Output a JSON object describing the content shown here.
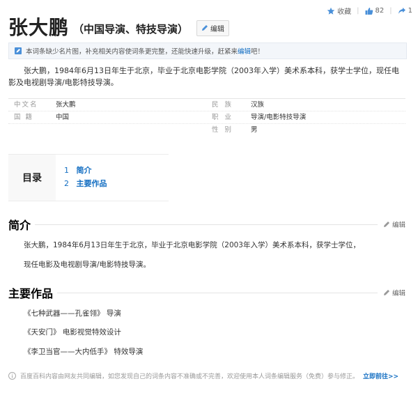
{
  "top": {
    "collect_label": "收藏",
    "like_count": "82",
    "share_count": "1"
  },
  "title": {
    "main": "张大鹏",
    "sub": "（中国导演、特技导演）",
    "edit_label": "编辑"
  },
  "notice": {
    "text": "本词条缺少名片图，补充相关内容使词条更完整，还能快速升级，赶紧来",
    "link": "编辑",
    "tail": "吧！"
  },
  "summary": "张大鹏，1984年6月13日年生于北京，毕业于北京电影学院（2003年入学）美术系本科，获学士学位，现任电影及电视剧导演/电影特技导演。",
  "basic_info": {
    "rows": [
      {
        "n1": "中文名",
        "v1": "张大鹏",
        "n2": "民 族",
        "v2": "汉族"
      },
      {
        "n1": "国 籍",
        "v1": "中国",
        "n2": "职 业",
        "v2": "导演/电影特技导演"
      },
      {
        "n1": "",
        "v1": "",
        "n2": "性 别",
        "v2": "男"
      }
    ]
  },
  "toc": {
    "label": "目录",
    "items": [
      {
        "num": "1",
        "text": "简介"
      },
      {
        "num": "2",
        "text": "主要作品"
      }
    ]
  },
  "section_intro": {
    "title": "简介",
    "edit_label": "编辑",
    "lines": [
      "张大鹏，1984年6月13日年生于北京，毕业于北京电影学院（2003年入学）美术系本科，获学士学位，",
      "现任电影及电视剧导演/电影特技导演。"
    ]
  },
  "section_works": {
    "title": "主要作品",
    "edit_label": "编辑",
    "items": [
      "《七种武器——孔雀翎》 导演",
      "《天安门》 电影视觉特效设计",
      "《李卫当官——大内低手》 特效导演"
    ]
  },
  "footer": {
    "text": "百度百科内容由网友共同编辑，如您发现自己的词条内容不准确或不完善，欢迎使用本人词条编辑服务（免费）参与修正。",
    "link": "立即前往>>"
  },
  "colors": {
    "link": "#136ec2",
    "text": "#333333",
    "muted": "#999999"
  }
}
